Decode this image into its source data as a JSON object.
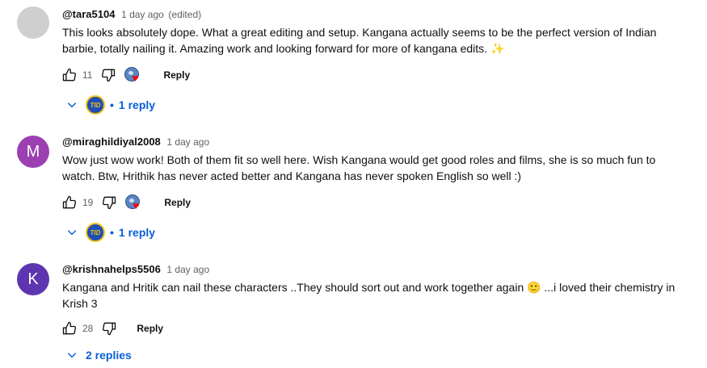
{
  "comments": [
    {
      "author": "@tara5104",
      "time": "1 day ago",
      "edited": "(edited)",
      "text": "This looks absolutely dope. What a great editing and setup. Kangana actually seems to be the perfect version of Indian barbie, totally nailing it. Amazing work and looking forward for more of kangana edits. ✨",
      "likes": "11",
      "reply_label": "Reply",
      "replies_label": "1 reply",
      "avatar_initial": "",
      "avatar_color": "#cfcfcf",
      "creator_heart": true,
      "replier_avatar_text": "TID"
    },
    {
      "author": "@miraghildiyal2008",
      "time": "1 day ago",
      "text": "Wow just wow work! Both of them fit so well here. Wish Kangana would get good roles and films, she is so much fun to watch. Btw, Hrithik has never acted better and Kangana has never spoken English so well :)",
      "likes": "19",
      "reply_label": "Reply",
      "replies_label": "1 reply",
      "avatar_initial": "M",
      "avatar_color": "#9c3fb0",
      "creator_heart": true,
      "replier_avatar_text": "TID"
    },
    {
      "author": "@krishnahelps5506",
      "time": "1 day ago",
      "text": "Kangana and Hritik can nail these characters ..They should sort out and work together again 🙂 ...i loved their chemistry in Krish 3",
      "likes": "28",
      "reply_label": "Reply",
      "replies_label": "2 replies",
      "avatar_initial": "K",
      "avatar_color": "#5e35b1",
      "creator_heart": false
    }
  ],
  "colors": {
    "link_blue": "#065fd4",
    "heart_red": "#ff0000",
    "meta_gray": "#606060"
  },
  "icons": [
    "thumbs-up-icon",
    "thumbs-down-icon",
    "creator-heart-icon",
    "chevron-down-icon"
  ]
}
